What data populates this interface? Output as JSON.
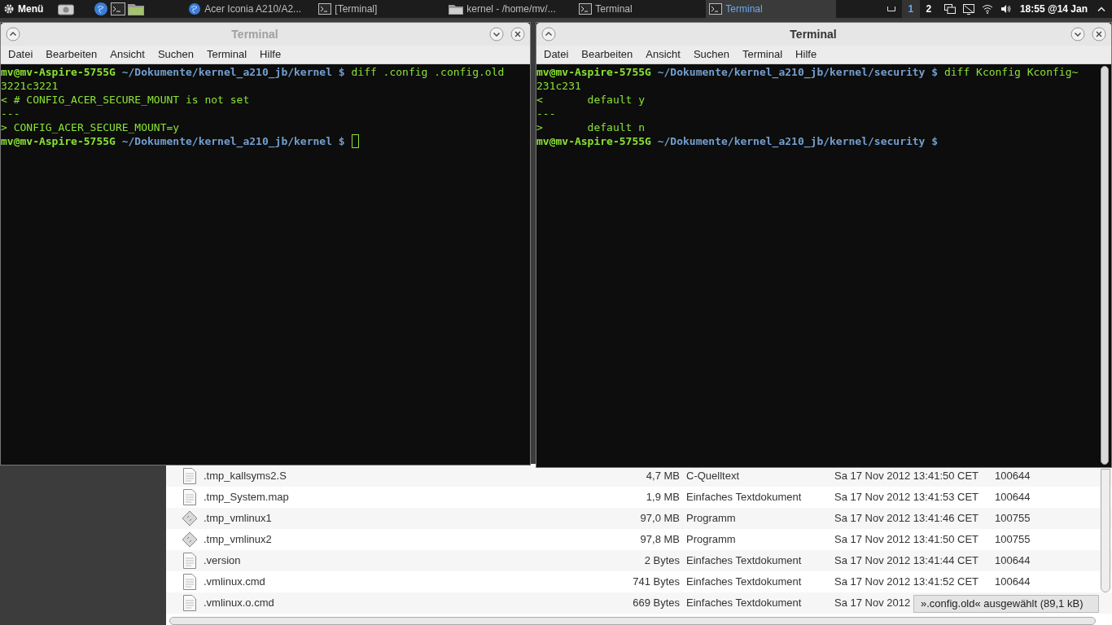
{
  "top_panel": {
    "menu_label": "Menü",
    "tasks": [
      {
        "label": "Acer Iconia A210/A2...",
        "kind": "browser",
        "selected": false
      },
      {
        "label": "[Terminal]",
        "kind": "terminal",
        "selected": false
      },
      {
        "label": "kernel - /home/mv/...",
        "kind": "files",
        "selected": false
      },
      {
        "label": "Terminal",
        "kind": "terminal",
        "selected": false
      },
      {
        "label": "Terminal",
        "kind": "terminal",
        "selected": true
      }
    ],
    "workspaces": [
      {
        "label": "1",
        "selected": true
      },
      {
        "label": "2",
        "selected": false
      }
    ],
    "clock": "18:55 @14 Jan"
  },
  "terminals": [
    {
      "title": "Terminal",
      "focused": false,
      "menu": [
        "Datei",
        "Bearbeiten",
        "Ansicht",
        "Suchen",
        "Terminal",
        "Hilfe"
      ],
      "lines": [
        {
          "segments": [
            {
              "kind": "user",
              "text": "mv@mv-Aspire-5755G"
            },
            {
              "kind": "path",
              "text": " ~/Dokumente/kernel_a210_jb/kernel $"
            },
            {
              "kind": "text",
              "text": " diff .config .config.old"
            }
          ]
        },
        {
          "segments": [
            {
              "kind": "text",
              "text": "3221c3221"
            }
          ]
        },
        {
          "segments": [
            {
              "kind": "text",
              "text": "< # CONFIG_ACER_SECURE_MOUNT is not set"
            }
          ]
        },
        {
          "segments": [
            {
              "kind": "text",
              "text": "---"
            }
          ]
        },
        {
          "segments": [
            {
              "kind": "text",
              "text": "> CONFIG_ACER_SECURE_MOUNT=y"
            }
          ]
        },
        {
          "segments": [
            {
              "kind": "user",
              "text": "mv@mv-Aspire-5755G"
            },
            {
              "kind": "path",
              "text": " ~/Dokumente/kernel_a210_jb/kernel $"
            }
          ],
          "cursor": true
        }
      ]
    },
    {
      "title": "Terminal",
      "focused": true,
      "menu": [
        "Datei",
        "Bearbeiten",
        "Ansicht",
        "Suchen",
        "Terminal",
        "Hilfe"
      ],
      "lines": [
        {
          "segments": [
            {
              "kind": "user",
              "text": "mv@mv-Aspire-5755G"
            },
            {
              "kind": "path",
              "text": " ~/Dokumente/kernel_a210_jb/kernel/security $"
            },
            {
              "kind": "text",
              "text": " diff Kconfig Kconfig~"
            }
          ]
        },
        {
          "segments": [
            {
              "kind": "text",
              "text": "231c231"
            }
          ]
        },
        {
          "segments": [
            {
              "kind": "text",
              "text": "<       default y"
            }
          ]
        },
        {
          "segments": [
            {
              "kind": "text",
              "text": "---"
            }
          ]
        },
        {
          "segments": [
            {
              "kind": "text",
              "text": ">       default n"
            }
          ]
        },
        {
          "segments": [
            {
              "kind": "user",
              "text": "mv@mv-Aspire-5755G"
            },
            {
              "kind": "path",
              "text": " ~/Dokumente/kernel_a210_jb/kernel/security $"
            }
          ]
        }
      ]
    }
  ],
  "file_list": {
    "rows": [
      {
        "kind": "text",
        "name": ".tmp_kallsyms2.S",
        "size": "4,7 MB",
        "type": "C-Quelltext",
        "modified": "Sa 17 Nov 2012 13:41:50 CET",
        "permissions": "100644"
      },
      {
        "kind": "text",
        "name": ".tmp_System.map",
        "size": "1,9 MB",
        "type": "Einfaches Textdokument",
        "modified": "Sa 17 Nov 2012 13:41:53 CET",
        "permissions": "100644"
      },
      {
        "kind": "program",
        "name": ".tmp_vmlinux1",
        "size": "97,0 MB",
        "type": "Programm",
        "modified": "Sa 17 Nov 2012 13:41:46 CET",
        "permissions": "100755"
      },
      {
        "kind": "program",
        "name": ".tmp_vmlinux2",
        "size": "97,8 MB",
        "type": "Programm",
        "modified": "Sa 17 Nov 2012 13:41:50 CET",
        "permissions": "100755"
      },
      {
        "kind": "text",
        "name": ".version",
        "size": "2 Bytes",
        "type": "Einfaches Textdokument",
        "modified": "Sa 17 Nov 2012 13:41:44 CET",
        "permissions": "100644"
      },
      {
        "kind": "text",
        "name": ".vmlinux.cmd",
        "size": "741 Bytes",
        "type": "Einfaches Textdokument",
        "modified": "Sa 17 Nov 2012 13:41:52 CET",
        "permissions": "100644"
      },
      {
        "kind": "text",
        "name": ".vmlinux.o.cmd",
        "size": "669 Bytes",
        "type": "Einfaches Textdokument",
        "modified": "Sa 17 Nov 2012"
      }
    ],
    "status": "».config.old« ausgewählt (89,1 kB)"
  }
}
